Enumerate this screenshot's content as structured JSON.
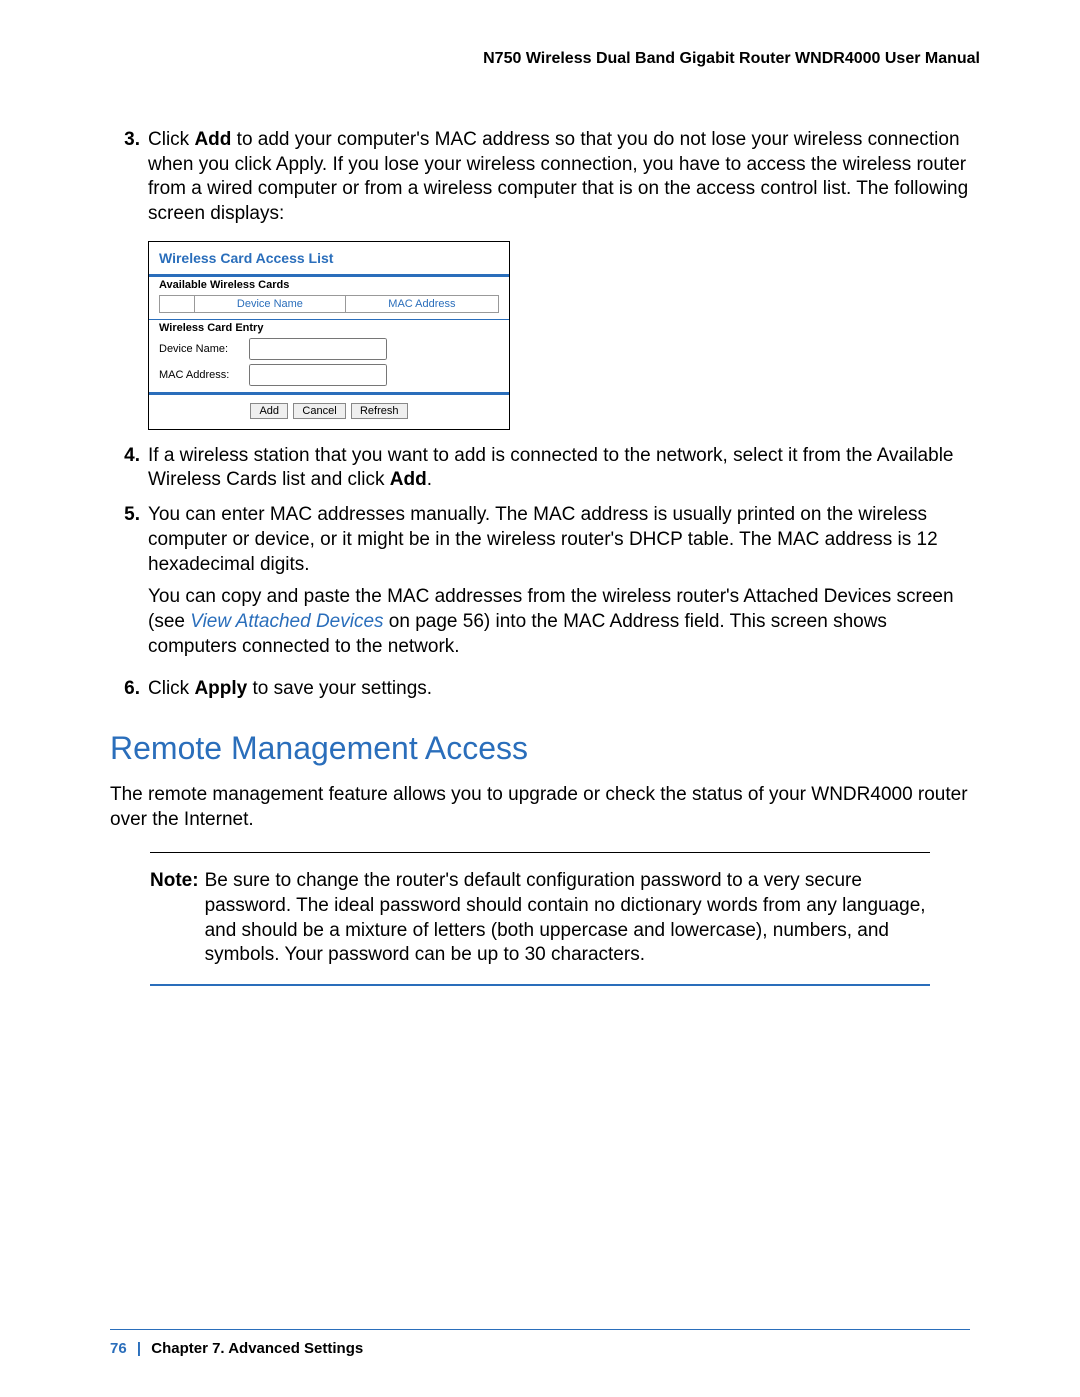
{
  "header": "N750 Wireless Dual Band Gigabit Router WNDR4000 User Manual",
  "steps_part1": {
    "num3": "3.",
    "text3a": "Click ",
    "text3b": "Add",
    "text3c": " to add your computer's MAC address so that you do not lose your wireless connection when you click Apply. If you lose your wireless connection, you have to access the wireless router from a wired computer or from a wireless computer that is on the access control list. The following screen displays:"
  },
  "panel": {
    "title": "Wireless Card Access List",
    "available_label": "Available Wireless Cards",
    "col_device": "Device Name",
    "col_mac": "MAC Address",
    "entry_label": "Wireless Card Entry",
    "device_name_label": "Device Name:",
    "mac_label": "MAC Address:",
    "btn_add": "Add",
    "btn_cancel": "Cancel",
    "btn_refresh": "Refresh"
  },
  "steps_part2": {
    "num4": "4.",
    "text4a": "If a wireless station that you want to add is connected to the network, select it from the Available Wireless Cards list and click ",
    "text4b": "Add",
    "text4c": ".",
    "num5": "5.",
    "text5": "You can enter MAC addresses manually. The MAC address is usually printed on the wireless computer or device, or it might be in the wireless router's DHCP table. The MAC address is 12 hexadecimal digits.",
    "text5sub_a": "You can copy and paste the MAC addresses from the wireless router's Attached Devices screen (see ",
    "text5sub_link": "View Attached Devices ",
    "text5sub_b": "on page 56) into the MAC Address field. This screen shows computers connected to the network.",
    "num6": "6.",
    "text6a": "Click ",
    "text6b": "Apply",
    "text6c": " to save your settings."
  },
  "heading": "Remote Management Access",
  "section_para": "The remote management feature allows you to upgrade or check the status of your WNDR4000 router over the Internet.",
  "note": {
    "label": "Note:",
    "text": "Be sure to change the router's default configuration password to a very secure password. The ideal password should contain no dictionary words from any language, and should be a mixture of letters (both uppercase and lowercase), numbers, and symbols. Your password can be up to 30 characters."
  },
  "footer": {
    "page": "76",
    "sep": "|",
    "chapter": "Chapter 7.  Advanced Settings"
  }
}
